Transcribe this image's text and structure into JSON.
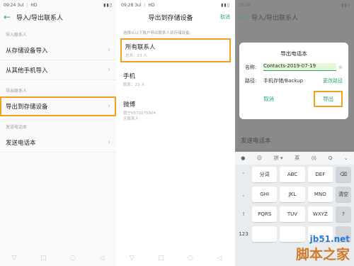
{
  "panel1": {
    "status_time": "09:24",
    "status_icons": "3ul ⋮ HD",
    "status_right": "▮▮▯",
    "back": "←",
    "title": "导入/导出联系人",
    "section_import": "导入联系人",
    "row_storage_import": "从存储设备导入",
    "row_phone_import": "从其他手机导入",
    "section_export": "导出联系人",
    "row_export": "导出到存储设备",
    "section_send": "发送电话本",
    "row_send": "发送电话本",
    "chevron": "›"
  },
  "panel2": {
    "status_time": "09:28",
    "status_icons": "3ul ⋮ HD",
    "title": "导出到存储设备",
    "cancel": "取消",
    "hint": "选择从以下账户导出联系人到存储设备。",
    "items": [
      {
        "name": "所有联系人",
        "sub": "总共：23 人"
      },
      {
        "name": "手机",
        "sub": "联系：23 人"
      },
      {
        "name": "微博",
        "sub": "姚宁6579275904\n无联系人"
      }
    ]
  },
  "panel3": {
    "status_time": "09:28",
    "back": "←",
    "title": "导入/导出联系人",
    "row_send": "发送电话本",
    "dialog_title": "导出电话本",
    "name_label": "名称:",
    "name_value": "Contacts-2019-07-19",
    "clear": "⊗",
    "path_label": "路径:",
    "path_value": "手机存储/Backup",
    "change_path": "更改路径",
    "cancel": "取消",
    "export": "导出",
    "keyboard_top": [
      "●",
      "☺",
      "拼 ▾",
      "英",
      "⟨I⟩",
      "Q",
      "⌄"
    ],
    "rows": [
      {
        "side": "'",
        "keys": [
          "分词",
          "ABC",
          "DEF"
        ],
        "fn": "⌫"
      },
      {
        "side": ",",
        "keys": [
          "GHI",
          "JKL",
          "MNO"
        ],
        "fn": "清空"
      },
      {
        "side": "!",
        "keys": [
          "PQRS",
          "TUV",
          "WXYZ"
        ],
        "fn": "?"
      },
      {
        "side": "123",
        "keys": [
          "",
          "",
          ""
        ],
        "fn": ""
      }
    ]
  },
  "nav": {
    "back": "▽",
    "home": "○",
    "recent": "◁",
    "square": "□"
  },
  "watermark": {
    "line1": "jb51.net",
    "line2": "脚本之家"
  }
}
